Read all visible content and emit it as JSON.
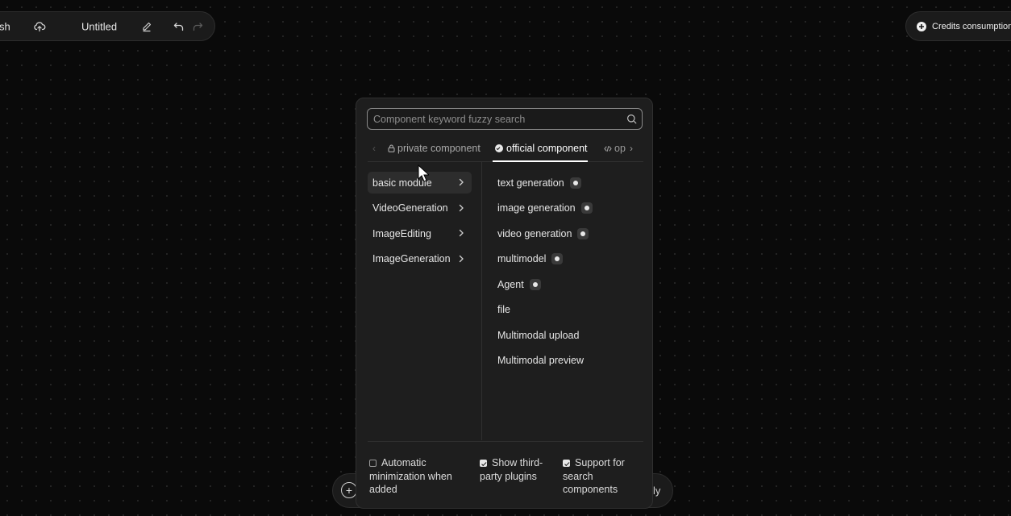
{
  "toolbar": {
    "publish_label": "sh",
    "title": "Untitled",
    "icons": [
      "cloud-upload-icon",
      "pencil-icon",
      "undo-icon",
      "redo-icon"
    ]
  },
  "credits": {
    "label": "Credits consumption",
    "icon": "plus-circle-icon"
  },
  "bottom_bar": {
    "label": "ly",
    "add_icon": "plus-circle-icon"
  },
  "panel": {
    "search": {
      "placeholder": "Component keyword fuzzy search",
      "value": ""
    },
    "tabs": [
      {
        "label": "private component",
        "icon": "lock-icon"
      },
      {
        "label": "official component",
        "icon": "official-badge-icon",
        "active": true
      },
      {
        "label": "op",
        "icon": "code-icon"
      }
    ],
    "categories": [
      {
        "label": "basic module",
        "active": true
      },
      {
        "label": "VideoGeneration"
      },
      {
        "label": "ImageEditing"
      },
      {
        "label": "ImageGeneration"
      }
    ],
    "components": [
      {
        "label": "text generation",
        "badge": true
      },
      {
        "label": "image generation",
        "badge": true
      },
      {
        "label": "video generation",
        "badge": true
      },
      {
        "label": "multimodel",
        "badge": true
      },
      {
        "label": "Agent",
        "badge": true
      },
      {
        "label": "file",
        "badge": false
      },
      {
        "label": "Multimodal upload",
        "badge": false
      },
      {
        "label": "Multimodal preview",
        "badge": false
      }
    ],
    "options": {
      "auto_minimize": {
        "label": "Automatic minimization when added",
        "checked": false
      },
      "third_party": {
        "label": "Show third-party plugins",
        "checked": true
      },
      "search_components": {
        "label": "Support for search components",
        "checked": true
      }
    }
  },
  "colors": {
    "background": "#0a0a0a",
    "panel": "#1e1e1e",
    "active_item": "#2d2d2d",
    "text": "#e6e6e6"
  }
}
